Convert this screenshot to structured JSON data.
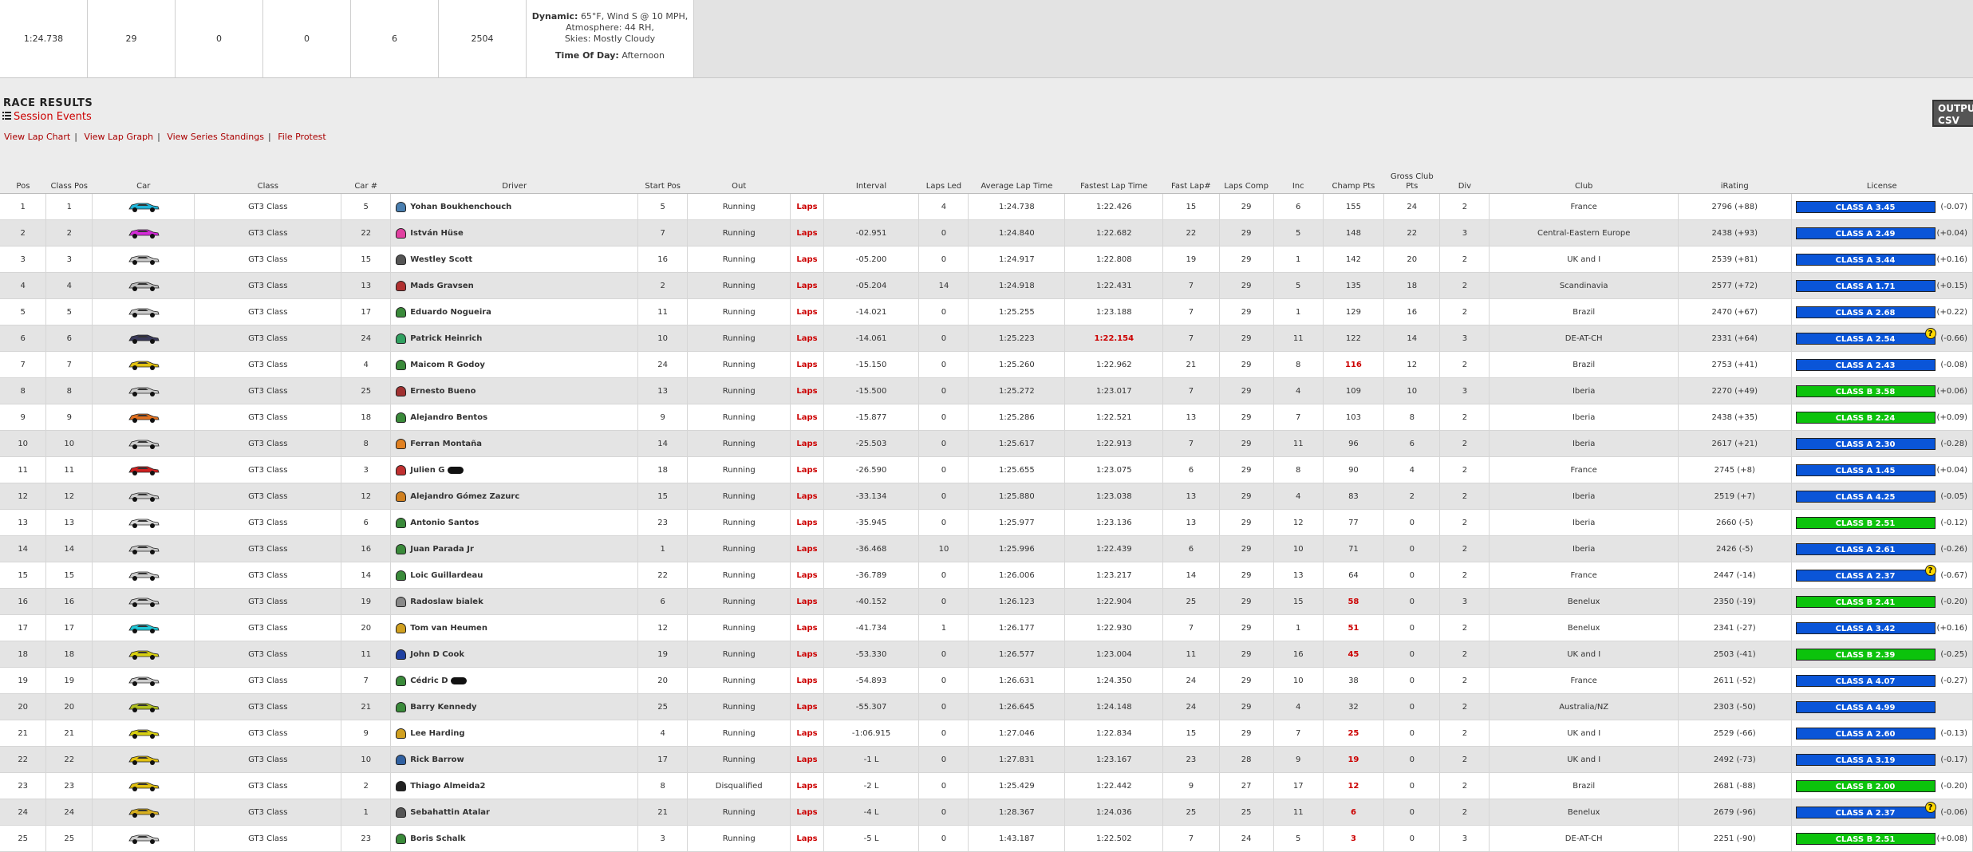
{
  "summary": {
    "cells": [
      "1:24.738",
      "29",
      "0",
      "0",
      "6",
      "2504"
    ],
    "weather": {
      "dynamic_label": "Dynamic:",
      "line1": "65°F, Wind S @ 10 MPH,",
      "line2": "Atmosphere: 44 RH,",
      "line3": "Skies: Mostly Cloudy",
      "tod_label": "Time Of Day:",
      "tod_value": "Afternoon"
    }
  },
  "results": {
    "title": "RACE RESULTS",
    "session_events": "Session Events",
    "links": [
      "View Lap Chart",
      "View Lap Graph",
      "View Series Standings",
      "File Protest"
    ],
    "output_button": "OUTPUT CSV"
  },
  "columns": [
    "Pos",
    "Class Pos",
    "Car",
    "Class",
    "Car #",
    "Driver",
    "Start Pos",
    "Out",
    "",
    "Interval",
    "Laps Led",
    "Average Lap Time",
    "Fastest Lap Time",
    "Fast Lap#",
    "Laps Comp",
    "Inc",
    "Champ Pts",
    "Gross Club Pts",
    "Div",
    "Club",
    "iRating",
    "License"
  ],
  "laps_link_label": "Laps",
  "rows": [
    {
      "pos": "1",
      "cpos": "1",
      "car_color": "#1fb4d8",
      "cls": "GT3 Class",
      "num": "5",
      "driver": "Yohan Boukhenchouch",
      "helmet": "#4a7fb0",
      "start": "5",
      "out": "Running",
      "interval": "",
      "led": "4",
      "avg": "1:24.738",
      "fast": "1:22.426",
      "fast_red": false,
      "flap": "15",
      "comp": "29",
      "inc": "6",
      "champ": "155",
      "champ_red": false,
      "club_pts": "24",
      "div": "2",
      "club": "France",
      "irating": "2796 (+88)",
      "lic": "CLASS A 3.45",
      "lic_type": "A",
      "q": false,
      "chg": "(-0.07)",
      "blur": false
    },
    {
      "pos": "2",
      "cpos": "2",
      "car_color": "#d42bd8",
      "cls": "GT3 Class",
      "num": "22",
      "driver": "István Hüse",
      "helmet": "#e040a0",
      "start": "7",
      "out": "Running",
      "interval": "-02.951",
      "led": "0",
      "avg": "1:24.840",
      "fast": "1:22.682",
      "fast_red": false,
      "flap": "22",
      "comp": "29",
      "inc": "5",
      "champ": "148",
      "champ_red": false,
      "club_pts": "22",
      "div": "3",
      "club": "Central-Eastern Europe",
      "irating": "2438 (+93)",
      "lic": "CLASS A 2.49",
      "lic_type": "A",
      "q": false,
      "chg": "(+0.04)",
      "blur": false
    },
    {
      "pos": "3",
      "cpos": "3",
      "car_color": "#c8c8c8",
      "cls": "GT3 Class",
      "num": "15",
      "driver": "Westley Scott",
      "helmet": "#555555",
      "start": "16",
      "out": "Running",
      "interval": "-05.200",
      "led": "0",
      "avg": "1:24.917",
      "fast": "1:22.808",
      "fast_red": false,
      "flap": "19",
      "comp": "29",
      "inc": "1",
      "champ": "142",
      "champ_red": false,
      "club_pts": "20",
      "div": "2",
      "club": "UK and I",
      "irating": "2539 (+81)",
      "lic": "CLASS A 3.44",
      "lic_type": "A",
      "q": false,
      "chg": "(+0.16)",
      "blur": false
    },
    {
      "pos": "4",
      "cpos": "4",
      "car_color": "#bbbbbb",
      "cls": "GT3 Class",
      "num": "13",
      "driver": "Mads Gravsen",
      "helmet": "#b03030",
      "start": "2",
      "out": "Running",
      "interval": "-05.204",
      "led": "14",
      "avg": "1:24.918",
      "fast": "1:22.431",
      "fast_red": false,
      "flap": "7",
      "comp": "29",
      "inc": "5",
      "champ": "135",
      "champ_red": false,
      "club_pts": "18",
      "div": "2",
      "club": "Scandinavia",
      "irating": "2577 (+72)",
      "lic": "CLASS A 1.71",
      "lic_type": "A",
      "q": false,
      "chg": "(+0.15)",
      "blur": false
    },
    {
      "pos": "5",
      "cpos": "5",
      "car_color": "#cccccc",
      "cls": "GT3 Class",
      "num": "17",
      "driver": "Eduardo Nogueira",
      "helmet": "#3a8a3a",
      "start": "11",
      "out": "Running",
      "interval": "-14.021",
      "led": "0",
      "avg": "1:25.255",
      "fast": "1:23.188",
      "fast_red": false,
      "flap": "7",
      "comp": "29",
      "inc": "1",
      "champ": "129",
      "champ_red": false,
      "club_pts": "16",
      "div": "2",
      "club": "Brazil",
      "irating": "2470 (+67)",
      "lic": "CLASS A 2.68",
      "lic_type": "A",
      "q": false,
      "chg": "(+0.22)",
      "blur": false
    },
    {
      "pos": "6",
      "cpos": "6",
      "car_color": "#3a3a5a",
      "cls": "GT3 Class",
      "num": "24",
      "driver": "Patrick Heinrich",
      "helmet": "#30a060",
      "start": "10",
      "out": "Running",
      "interval": "-14.061",
      "led": "0",
      "avg": "1:25.223",
      "fast": "1:22.154",
      "fast_red": true,
      "flap": "7",
      "comp": "29",
      "inc": "11",
      "champ": "122",
      "champ_red": false,
      "club_pts": "14",
      "div": "3",
      "club": "DE-AT-CH",
      "irating": "2331 (+64)",
      "lic": "CLASS A 2.54",
      "lic_type": "A",
      "q": true,
      "chg": "(-0.66)",
      "blur": false
    },
    {
      "pos": "7",
      "cpos": "7",
      "car_color": "#e0c010",
      "cls": "GT3 Class",
      "num": "4",
      "driver": "Maicom R Godoy",
      "helmet": "#3a8a3a",
      "start": "24",
      "out": "Running",
      "interval": "-15.150",
      "led": "0",
      "avg": "1:25.260",
      "fast": "1:22.962",
      "fast_red": false,
      "flap": "21",
      "comp": "29",
      "inc": "8",
      "champ": "116",
      "champ_red": true,
      "club_pts": "12",
      "div": "2",
      "club": "Brazil",
      "irating": "2753 (+41)",
      "lic": "CLASS A 2.43",
      "lic_type": "A",
      "q": false,
      "chg": "(-0.08)",
      "blur": false
    },
    {
      "pos": "8",
      "cpos": "8",
      "car_color": "#cccccc",
      "cls": "GT3 Class",
      "num": "25",
      "driver": "Ernesto Bueno",
      "helmet": "#a03030",
      "start": "13",
      "out": "Running",
      "interval": "-15.500",
      "led": "0",
      "avg": "1:25.272",
      "fast": "1:23.017",
      "fast_red": false,
      "flap": "7",
      "comp": "29",
      "inc": "4",
      "champ": "109",
      "champ_red": false,
      "club_pts": "10",
      "div": "3",
      "club": "Iberia",
      "irating": "2270 (+49)",
      "lic": "CLASS B 3.58",
      "lic_type": "B",
      "q": false,
      "chg": "(+0.06)",
      "blur": false
    },
    {
      "pos": "9",
      "cpos": "9",
      "car_color": "#e07020",
      "cls": "GT3 Class",
      "num": "18",
      "driver": "Alejandro Bentos",
      "helmet": "#3a8a3a",
      "start": "9",
      "out": "Running",
      "interval": "-15.877",
      "led": "0",
      "avg": "1:25.286",
      "fast": "1:22.521",
      "fast_red": false,
      "flap": "13",
      "comp": "29",
      "inc": "7",
      "champ": "103",
      "champ_red": false,
      "club_pts": "8",
      "div": "2",
      "club": "Iberia",
      "irating": "2438 (+35)",
      "lic": "CLASS B 2.24",
      "lic_type": "B",
      "q": false,
      "chg": "(+0.09)",
      "blur": false
    },
    {
      "pos": "10",
      "cpos": "10",
      "car_color": "#cccccc",
      "cls": "GT3 Class",
      "num": "8",
      "driver": "Ferran Montaña",
      "helmet": "#e08020",
      "start": "14",
      "out": "Running",
      "interval": "-25.503",
      "led": "0",
      "avg": "1:25.617",
      "fast": "1:22.913",
      "fast_red": false,
      "flap": "7",
      "comp": "29",
      "inc": "11",
      "champ": "96",
      "champ_red": false,
      "club_pts": "6",
      "div": "2",
      "club": "Iberia",
      "irating": "2617 (+21)",
      "lic": "CLASS A 2.30",
      "lic_type": "A",
      "q": false,
      "chg": "(-0.28)",
      "blur": false
    },
    {
      "pos": "11",
      "cpos": "11",
      "car_color": "#d02020",
      "cls": "GT3 Class",
      "num": "3",
      "driver": "Julien G",
      "helmet": "#c03030",
      "start": "18",
      "out": "Running",
      "interval": "-26.590",
      "led": "0",
      "avg": "1:25.655",
      "fast": "1:23.075",
      "fast_red": false,
      "flap": "6",
      "comp": "29",
      "inc": "8",
      "champ": "90",
      "champ_red": false,
      "club_pts": "4",
      "div": "2",
      "club": "France",
      "irating": "2745 (+8)",
      "lic": "CLASS A 1.45",
      "lic_type": "A",
      "q": false,
      "chg": "(+0.04)",
      "blur": true
    },
    {
      "pos": "12",
      "cpos": "12",
      "car_color": "#cccccc",
      "cls": "GT3 Class",
      "num": "12",
      "driver": "Alejandro Gómez Zazurc",
      "helmet": "#d08020",
      "start": "15",
      "out": "Running",
      "interval": "-33.134",
      "led": "0",
      "avg": "1:25.880",
      "fast": "1:23.038",
      "fast_red": false,
      "flap": "13",
      "comp": "29",
      "inc": "4",
      "champ": "83",
      "champ_red": false,
      "club_pts": "2",
      "div": "2",
      "club": "Iberia",
      "irating": "2519 (+7)",
      "lic": "CLASS A 4.25",
      "lic_type": "A",
      "q": false,
      "chg": "(-0.05)",
      "blur": false
    },
    {
      "pos": "13",
      "cpos": "13",
      "car_color": "#d8d8d8",
      "cls": "GT3 Class",
      "num": "6",
      "driver": "Antonio Santos",
      "helmet": "#3a8a3a",
      "start": "23",
      "out": "Running",
      "interval": "-35.945",
      "led": "0",
      "avg": "1:25.977",
      "fast": "1:23.136",
      "fast_red": false,
      "flap": "13",
      "comp": "29",
      "inc": "12",
      "champ": "77",
      "champ_red": false,
      "club_pts": "0",
      "div": "2",
      "club": "Iberia",
      "irating": "2660 (-5)",
      "lic": "CLASS B 2.51",
      "lic_type": "B",
      "q": false,
      "chg": "(-0.12)",
      "blur": false
    },
    {
      "pos": "14",
      "cpos": "14",
      "car_color": "#cccccc",
      "cls": "GT3 Class",
      "num": "16",
      "driver": "Juan Parada Jr",
      "helmet": "#3a8a3a",
      "start": "1",
      "out": "Running",
      "interval": "-36.468",
      "led": "10",
      "avg": "1:25.996",
      "fast": "1:22.439",
      "fast_red": false,
      "flap": "6",
      "comp": "29",
      "inc": "10",
      "champ": "71",
      "champ_red": false,
      "club_pts": "0",
      "div": "2",
      "club": "Iberia",
      "irating": "2426 (-5)",
      "lic": "CLASS A 2.61",
      "lic_type": "A",
      "q": false,
      "chg": "(-0.26)",
      "blur": false
    },
    {
      "pos": "15",
      "cpos": "15",
      "car_color": "#cccccc",
      "cls": "GT3 Class",
      "num": "14",
      "driver": "Loic Guillardeau",
      "helmet": "#3a8a3a",
      "start": "22",
      "out": "Running",
      "interval": "-36.789",
      "led": "0",
      "avg": "1:26.006",
      "fast": "1:23.217",
      "fast_red": false,
      "flap": "14",
      "comp": "29",
      "inc": "13",
      "champ": "64",
      "champ_red": false,
      "club_pts": "0",
      "div": "2",
      "club": "France",
      "irating": "2447 (-14)",
      "lic": "CLASS A 2.37",
      "lic_type": "A",
      "q": true,
      "chg": "(-0.67)",
      "blur": false
    },
    {
      "pos": "16",
      "cpos": "16",
      "car_color": "#cccccc",
      "cls": "GT3 Class",
      "num": "19",
      "driver": "Radoslaw bialek",
      "helmet": "#888888",
      "start": "6",
      "out": "Running",
      "interval": "-40.152",
      "led": "0",
      "avg": "1:26.123",
      "fast": "1:22.904",
      "fast_red": false,
      "flap": "25",
      "comp": "29",
      "inc": "15",
      "champ": "58",
      "champ_red": true,
      "club_pts": "0",
      "div": "3",
      "club": "Benelux",
      "irating": "2350 (-19)",
      "lic": "CLASS B 2.41",
      "lic_type": "B",
      "q": false,
      "chg": "(-0.20)",
      "blur": false
    },
    {
      "pos": "17",
      "cpos": "17",
      "car_color": "#20c8d8",
      "cls": "GT3 Class",
      "num": "20",
      "driver": "Tom van Heumen",
      "helmet": "#d0a020",
      "start": "12",
      "out": "Running",
      "interval": "-41.734",
      "led": "1",
      "avg": "1:26.177",
      "fast": "1:22.930",
      "fast_red": false,
      "flap": "7",
      "comp": "29",
      "inc": "1",
      "champ": "51",
      "champ_red": true,
      "club_pts": "0",
      "div": "2",
      "club": "Benelux",
      "irating": "2341 (-27)",
      "lic": "CLASS A 3.42",
      "lic_type": "A",
      "q": false,
      "chg": "(+0.16)",
      "blur": false
    },
    {
      "pos": "18",
      "cpos": "18",
      "car_color": "#d8d010",
      "cls": "GT3 Class",
      "num": "11",
      "driver": "John D Cook",
      "helmet": "#2040a0",
      "start": "19",
      "out": "Running",
      "interval": "-53.330",
      "led": "0",
      "avg": "1:26.577",
      "fast": "1:23.004",
      "fast_red": false,
      "flap": "11",
      "comp": "29",
      "inc": "16",
      "champ": "45",
      "champ_red": true,
      "club_pts": "0",
      "div": "2",
      "club": "UK and I",
      "irating": "2503 (-41)",
      "lic": "CLASS B 2.39",
      "lic_type": "B",
      "q": false,
      "chg": "(-0.25)",
      "blur": false
    },
    {
      "pos": "19",
      "cpos": "19",
      "car_color": "#cccccc",
      "cls": "GT3 Class",
      "num": "7",
      "driver": "Cédric D",
      "helmet": "#3a8a3a",
      "start": "20",
      "out": "Running",
      "interval": "-54.893",
      "led": "0",
      "avg": "1:26.631",
      "fast": "1:24.350",
      "fast_red": false,
      "flap": "24",
      "comp": "29",
      "inc": "10",
      "champ": "38",
      "champ_red": false,
      "club_pts": "0",
      "div": "2",
      "club": "France",
      "irating": "2611 (-52)",
      "lic": "CLASS A 4.07",
      "lic_type": "A",
      "q": false,
      "chg": "(-0.27)",
      "blur": true
    },
    {
      "pos": "20",
      "cpos": "20",
      "car_color": "#b0c020",
      "cls": "GT3 Class",
      "num": "21",
      "driver": "Barry Kennedy",
      "helmet": "#3a8a3a",
      "start": "25",
      "out": "Running",
      "interval": "-55.307",
      "led": "0",
      "avg": "1:26.645",
      "fast": "1:24.148",
      "fast_red": false,
      "flap": "24",
      "comp": "29",
      "inc": "4",
      "champ": "32",
      "champ_red": false,
      "club_pts": "0",
      "div": "2",
      "club": "Australia/NZ",
      "irating": "2303 (-50)",
      "lic": "CLASS A 4.99",
      "lic_type": "A",
      "q": false,
      "chg": "",
      "blur": false
    },
    {
      "pos": "21",
      "cpos": "21",
      "car_color": "#d8d010",
      "cls": "GT3 Class",
      "num": "9",
      "driver": "Lee Harding",
      "helmet": "#d0a020",
      "start": "4",
      "out": "Running",
      "interval": "-1:06.915",
      "led": "0",
      "avg": "1:27.046",
      "fast": "1:22.834",
      "fast_red": false,
      "flap": "15",
      "comp": "29",
      "inc": "7",
      "champ": "25",
      "champ_red": true,
      "club_pts": "0",
      "div": "2",
      "club": "UK and I",
      "irating": "2529 (-66)",
      "lic": "CLASS A 2.60",
      "lic_type": "A",
      "q": false,
      "chg": "(-0.13)",
      "blur": false
    },
    {
      "pos": "22",
      "cpos": "22",
      "car_color": "#e0c010",
      "cls": "GT3 Class",
      "num": "10",
      "driver": "Rick Barrow",
      "helmet": "#3060a0",
      "start": "17",
      "out": "Running",
      "interval": "-1 L",
      "led": "0",
      "avg": "1:27.831",
      "fast": "1:23.167",
      "fast_red": false,
      "flap": "23",
      "comp": "28",
      "inc": "9",
      "champ": "19",
      "champ_red": true,
      "club_pts": "0",
      "div": "2",
      "club": "UK and I",
      "irating": "2492 (-73)",
      "lic": "CLASS A 3.19",
      "lic_type": "A",
      "q": false,
      "chg": "(-0.17)",
      "blur": false
    },
    {
      "pos": "23",
      "cpos": "23",
      "car_color": "#e0c010",
      "cls": "GT3 Class",
      "num": "2",
      "driver": "Thiago Almeida2",
      "helmet": "#222222",
      "start": "8",
      "out": "Disqualified",
      "interval": "-2 L",
      "led": "0",
      "avg": "1:25.429",
      "fast": "1:22.442",
      "fast_red": false,
      "flap": "9",
      "comp": "27",
      "inc": "17",
      "champ": "12",
      "champ_red": true,
      "club_pts": "0",
      "div": "2",
      "club": "Brazil",
      "irating": "2681 (-88)",
      "lic": "CLASS B 2.00",
      "lic_type": "B",
      "q": false,
      "chg": "(-0.20)",
      "blur": false
    },
    {
      "pos": "24",
      "cpos": "24",
      "car_color": "#d8b020",
      "cls": "GT3 Class",
      "num": "1",
      "driver": "Sebahattin Atalar",
      "helmet": "#555555",
      "start": "21",
      "out": "Running",
      "interval": "-4 L",
      "led": "0",
      "avg": "1:28.367",
      "fast": "1:24.036",
      "fast_red": false,
      "flap": "25",
      "comp": "25",
      "inc": "11",
      "champ": "6",
      "champ_red": true,
      "club_pts": "0",
      "div": "2",
      "club": "Benelux",
      "irating": "2679 (-96)",
      "lic": "CLASS A 2.37",
      "lic_type": "A",
      "q": true,
      "chg": "(-0.06)",
      "blur": false
    },
    {
      "pos": "25",
      "cpos": "25",
      "car_color": "#cccccc",
      "cls": "GT3 Class",
      "num": "23",
      "driver": "Boris Schalk",
      "helmet": "#3a8a3a",
      "start": "3",
      "out": "Running",
      "interval": "-5 L",
      "led": "0",
      "avg": "1:43.187",
      "fast": "1:22.502",
      "fast_red": false,
      "flap": "7",
      "comp": "24",
      "inc": "5",
      "champ": "3",
      "champ_red": true,
      "club_pts": "0",
      "div": "3",
      "club": "DE-AT-CH",
      "irating": "2251 (-90)",
      "lic": "CLASS B 2.51",
      "lic_type": "B",
      "q": false,
      "chg": "(+0.08)",
      "blur": false
    }
  ],
  "colors": {
    "link_red": "#aa0000",
    "license_a": "#0a55d8",
    "license_b": "#0cc30c",
    "row_alt": "#e4e4e4"
  }
}
